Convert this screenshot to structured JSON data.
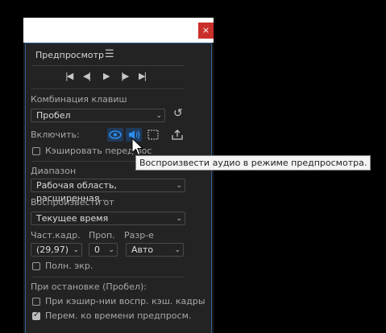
{
  "window": {
    "close_glyph": "×"
  },
  "panel": {
    "title": "Предпросмотр",
    "menu_glyph": "☰"
  },
  "transport": {
    "buttons": [
      {
        "name": "go-to-start",
        "glyph": "|◀"
      },
      {
        "name": "step-back",
        "glyph": "◀|"
      },
      {
        "name": "play",
        "glyph": "▶"
      },
      {
        "name": "step-forward",
        "glyph": "|▶"
      },
      {
        "name": "go-to-end",
        "glyph": "▶|"
      }
    ]
  },
  "shortcut": {
    "label": "Комбинация клавиш",
    "value": "Пробел",
    "reset_icon": "undo-icon"
  },
  "include": {
    "label": "Включить:",
    "video_icon": "eye-icon",
    "audio_icon": "speaker-icon",
    "overlay_icon": "bounding-box-icon",
    "export_icon": "export-icon"
  },
  "cache": {
    "label": "Кэшировать перед вос"
  },
  "range": {
    "label": "Диапазон",
    "value": "Рабочая область, расширенная..."
  },
  "play_from": {
    "label": "Воспроизвести от",
    "value": "Текущее время"
  },
  "frame_rate": {
    "label": "Част.кадр.",
    "value": "(29,97)"
  },
  "skip": {
    "label": "Проп.",
    "value": "0"
  },
  "resolution": {
    "label": "Разр-е",
    "value": "Авто"
  },
  "fullscreen": {
    "label": "Полн. экр."
  },
  "on_stop": {
    "label": "При остановке (Пробел):"
  },
  "option_cached": {
    "label": "При кэшир-нии воспр. кэш. кадры",
    "checked": false
  },
  "option_move_time": {
    "label": "Перем. ко времени предпросм.",
    "checked": true
  },
  "tooltip": {
    "text": "Воспроизвести аудио в режиме предпросмотра."
  },
  "colors": {
    "accent": "#2d8ceb",
    "panel_bg": "#232323",
    "close_red": "#c9302c"
  }
}
